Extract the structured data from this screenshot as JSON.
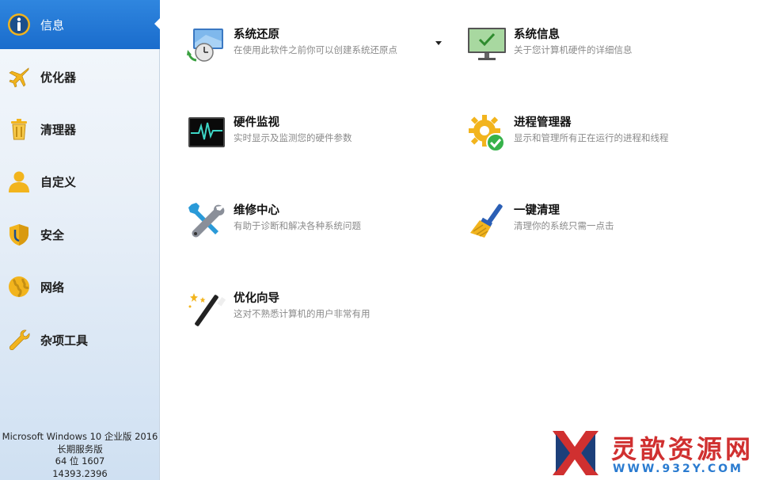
{
  "sidebar": {
    "items": [
      {
        "label": "信息",
        "icon": "info-icon"
      },
      {
        "label": "优化器",
        "icon": "airplane-icon"
      },
      {
        "label": "清理器",
        "icon": "trash-icon"
      },
      {
        "label": "自定义",
        "icon": "user-icon"
      },
      {
        "label": "安全",
        "icon": "shield-icon"
      },
      {
        "label": "网络",
        "icon": "globe-icon"
      },
      {
        "label": "杂项工具",
        "icon": "wrench-icon"
      }
    ],
    "active": 0,
    "system_info": [
      "Microsoft Windows 10 企业版 2016",
      "长期服务版",
      "64 位 1607",
      "14393.2396"
    ]
  },
  "tiles": [
    {
      "title": "系统还原",
      "desc": "在使用此软件之前你可以创建系统还原点",
      "icon": "system-restore-icon"
    },
    {
      "title": "系统信息",
      "desc": "关于您计算机硬件的详细信息",
      "icon": "monitor-check-icon"
    },
    {
      "title": "硬件监视",
      "desc": "实时显示及监测您的硬件参数",
      "icon": "hardware-monitor-icon"
    },
    {
      "title": "进程管理器",
      "desc": "显示和管理所有正在运行的进程和线程",
      "icon": "gear-check-icon"
    },
    {
      "title": "维修中心",
      "desc": "有助于诊断和解决各种系统问题",
      "icon": "tools-icon"
    },
    {
      "title": "一键清理",
      "desc": "清理你的系统只需一点击",
      "icon": "broom-icon"
    },
    {
      "title": "优化向导",
      "desc": "这对不熟悉计算机的用户非常有用",
      "icon": "magic-wand-icon"
    }
  ],
  "watermark": {
    "text": "灵歆资源网",
    "url": "WWW.932Y.COM"
  },
  "colors": {
    "accent": "#1f73d3",
    "sidebar_bg": "#e9f0f8",
    "icon_gold": "#f2b41d"
  }
}
